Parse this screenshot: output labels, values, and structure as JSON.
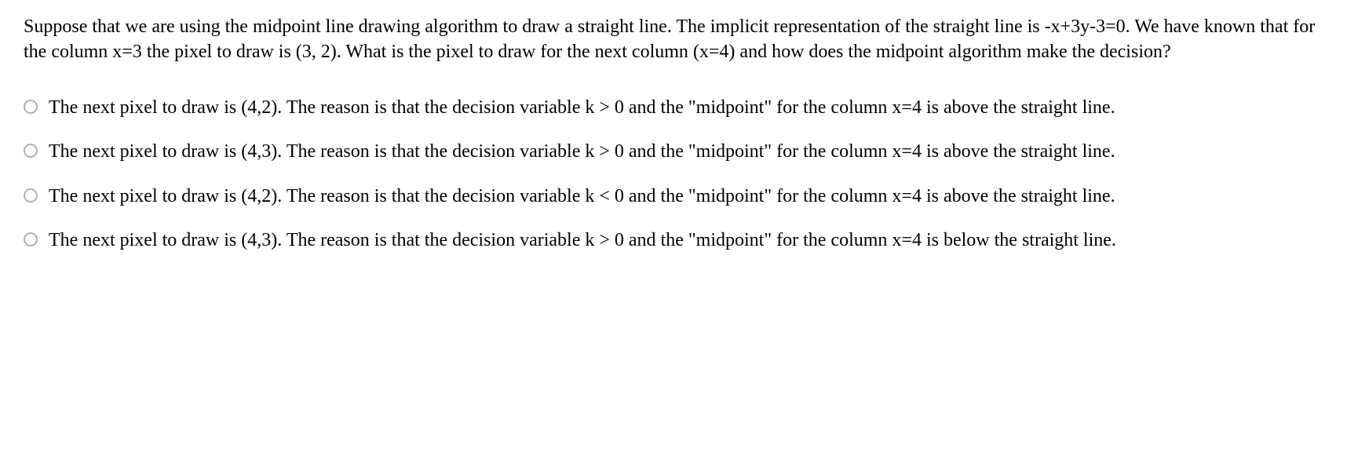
{
  "question": "Suppose that we are using the midpoint line drawing algorithm to draw a straight line. The implicit representation of the straight line is -x+3y-3=0. We have known that for the column x=3 the pixel to draw is (3, 2). What is the pixel to draw for the next column (x=4) and how does the midpoint algorithm make the decision?",
  "options": [
    "The next pixel to draw is (4,2). The reason is that the decision variable k > 0 and the \"midpoint\" for the column x=4 is above the straight line.",
    "The next pixel to draw is (4,3). The reason is that the decision variable k > 0 and the \"midpoint\" for the column x=4 is above the straight line.",
    "The next pixel to draw is (4,2). The reason is that the decision variable k < 0 and the \"midpoint\" for the column x=4 is above the straight line.",
    "The next pixel to draw is (4,3). The reason is that the decision variable k > 0 and the \"midpoint\" for the column x=4 is below the straight line."
  ]
}
